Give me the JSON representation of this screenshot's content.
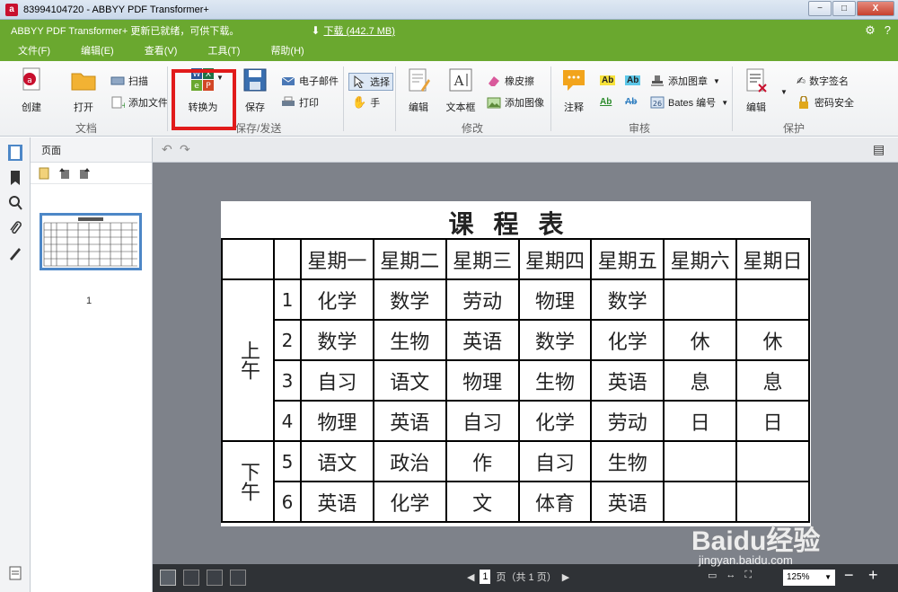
{
  "window": {
    "title": "83994104720 - ABBYY PDF Transformer+",
    "minimize": "−",
    "maximize": "□",
    "close": "X"
  },
  "update_bar": {
    "message": "ABBYY PDF Transformer+ 更新已就绪，可供下载。",
    "download_label": "下载 (442.7 MB)"
  },
  "menu": {
    "items": [
      "文件(F)",
      "编辑(E)",
      "查看(V)",
      "工具(T)",
      "帮助(H)"
    ]
  },
  "ribbon": {
    "groups": {
      "document": "文档",
      "save_send": "保存/发送",
      "modify": "修改",
      "review": "审核",
      "protect": "保护"
    },
    "buttons": {
      "create": "创建",
      "open": "打开",
      "scan": "扫描",
      "add_file": "添加文件",
      "convert_to": "转换为",
      "save": "保存",
      "email": "电子邮件",
      "print": "打印",
      "select": "选择",
      "hand": "手",
      "edit": "编辑",
      "textbox": "文本框",
      "eraser": "橡皮擦",
      "add_image": "添加图像",
      "comment": "注释",
      "add_stamp": "添加图章",
      "bates": "Bates 编号",
      "protect_edit": "编辑",
      "digital_sign": "数字签名",
      "password": "密码安全"
    }
  },
  "pages_panel": {
    "header": "页面",
    "thumb_number": "1"
  },
  "document": {
    "title": "课程表",
    "header_row": [
      "",
      "",
      "星期一",
      "星期二",
      "星期三",
      "星期四",
      "星期五",
      "星期六",
      "星期日"
    ],
    "morning_label": "上午",
    "afternoon_label": "下午",
    "rows": [
      {
        "idx": "1",
        "cells": [
          "化学",
          "数学",
          "劳动",
          "物理",
          "数学",
          "",
          ""
        ]
      },
      {
        "idx": "2",
        "cells": [
          "数学",
          "生物",
          "英语",
          "数学",
          "化学",
          "休",
          "休"
        ]
      },
      {
        "idx": "3",
        "cells": [
          "自习",
          "语文",
          "物理",
          "生物",
          "英语",
          "息",
          "息"
        ]
      },
      {
        "idx": "4",
        "cells": [
          "物理",
          "英语",
          "自习",
          "化学",
          "劳动",
          "日",
          "日"
        ]
      },
      {
        "idx": "5",
        "cells": [
          "语文",
          "政治",
          "作",
          "自习",
          "生物",
          "",
          ""
        ]
      },
      {
        "idx": "6",
        "cells": [
          "英语",
          "化学",
          "文",
          "体育",
          "英语",
          "",
          ""
        ]
      }
    ]
  },
  "status": {
    "page_current": "1",
    "page_label": "页（共 1 页）",
    "zoom": "125%"
  },
  "watermark": {
    "brand": "Baidu经验",
    "url": "jingyan.baidu.com"
  },
  "colors": {
    "accent_green": "#6aa82f",
    "highlight_red": "#e11b1b",
    "viewer_bg": "#7e828a"
  }
}
